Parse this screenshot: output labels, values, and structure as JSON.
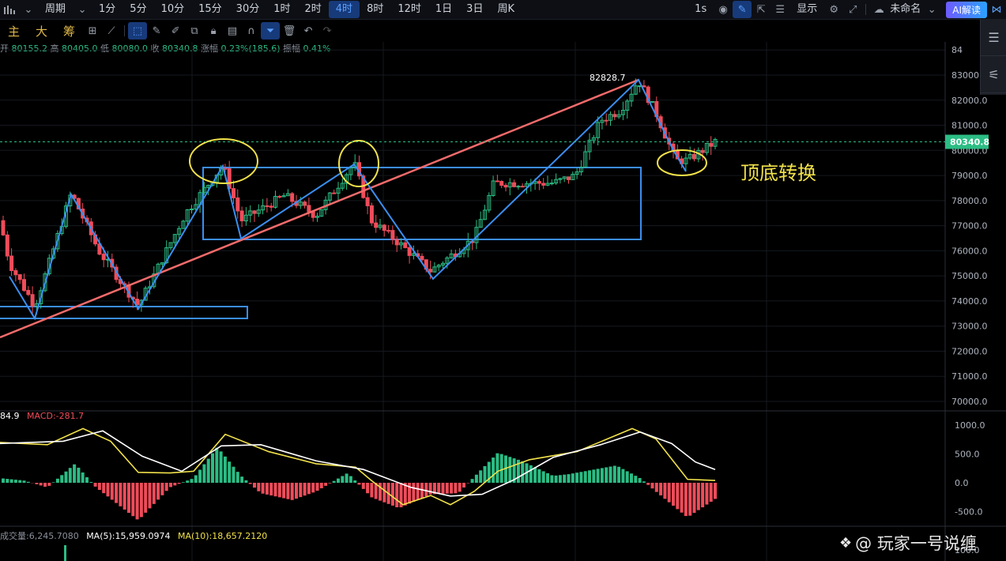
{
  "toolbar": {
    "period_label": "周期",
    "periods": [
      "1分",
      "5分",
      "10分",
      "15分",
      "30分",
      "1时",
      "2时",
      "4时",
      "8时",
      "12时",
      "1日",
      "3日",
      "周K"
    ],
    "active_period": "4时",
    "speed": "1s",
    "display_label": "显示",
    "layout_name": "未命名",
    "ai_label": "AI解读"
  },
  "tools": {
    "labels": [
      "主",
      "大",
      "筹"
    ]
  },
  "ohlc": {
    "open_label": "开",
    "open": "80155.2",
    "high_label": "高",
    "high": "80405.0",
    "low_label": "低",
    "low": "80080.0",
    "close_label": "收",
    "close": "80340.8",
    "change_label": "涨幅",
    "change": "0.23%(185.6)",
    "amplitude_label": "振幅",
    "amplitude": "0.41%"
  },
  "price_axis": {
    "ticks": [
      "84",
      "83000.0",
      "82000.0",
      "81000.0",
      "80000.0",
      "79000.0",
      "78000.0",
      "77000.0",
      "76000.0",
      "75000.0",
      "74000.0",
      "73000.0",
      "72000.0",
      "71000.0",
      "70000.0"
    ],
    "current_price": "80340.8",
    "peak_label": "82828.7"
  },
  "annotation": {
    "text": "顶底转换",
    "color": "#f2e24a"
  },
  "macd": {
    "left_value": "84.9",
    "label": "MACD:-281.7",
    "ticks": [
      "1000.0",
      "500.0",
      "0.0",
      "-500.0"
    ]
  },
  "volume": {
    "label": "成交量:6,245.7080",
    "ma5": "MA(5):15,959.0974",
    "ma10": "MA(10):18,657.2120",
    "tick": "100.0"
  },
  "watermark": "@ 玩家一号说缠",
  "colors": {
    "up": "#2bbd84",
    "down": "#ef4c5a",
    "trend": "#f26b6b",
    "zigzag": "#3b8ef0",
    "circle": "#f2e24a",
    "dif": "#ffffff",
    "dea": "#f2e24a"
  },
  "chart_data": {
    "type": "candlestick",
    "timeframe": "4时",
    "y_range": [
      70000,
      84000
    ],
    "last_close": 80340.8,
    "peak": 82828.7,
    "zigzag_pivots": [
      77200,
      74000,
      78400,
      74000,
      79500,
      76700,
      79600,
      75000,
      82828.7,
      79300
    ],
    "zones": [
      {
        "low": 73400,
        "high": 73800
      },
      {
        "low": 76600,
        "high": 79400
      }
    ],
    "trendline": {
      "from": 72500,
      "to": 82828.7
    },
    "macd_ticks": [
      1000,
      500,
      0,
      -500
    ],
    "macd_value": -281.7
  }
}
